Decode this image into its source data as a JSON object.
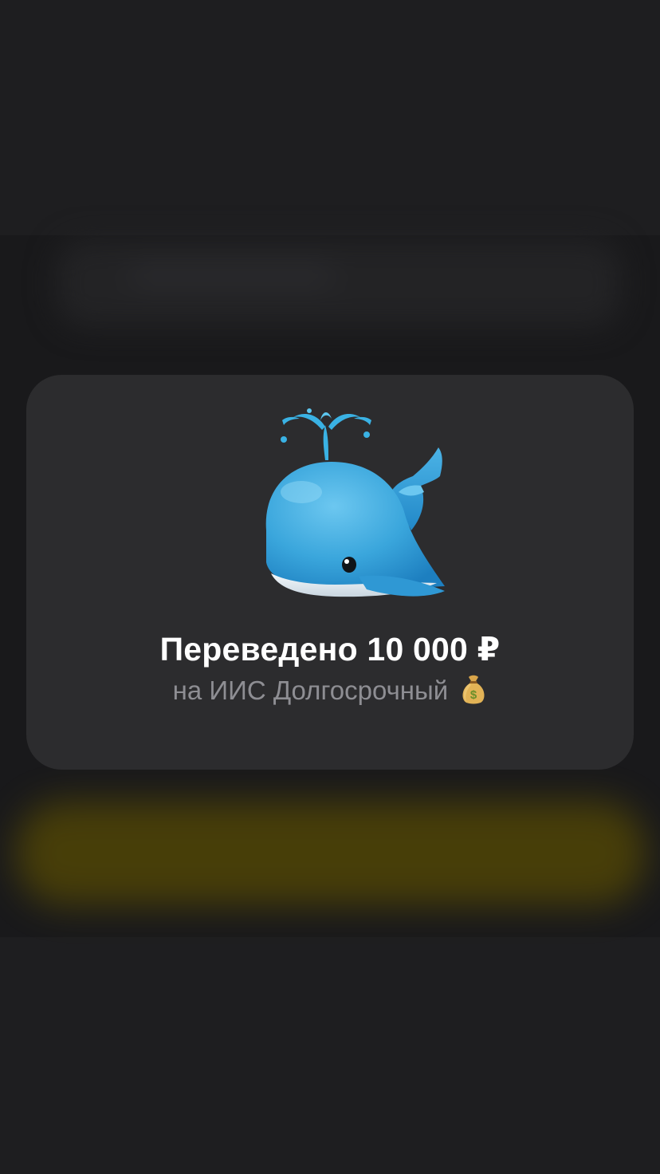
{
  "notification": {
    "title": "Переведено 10 000 ₽",
    "subtitle": "на ИИС Долгосрочный",
    "emoji_icon": "spouting-whale-icon",
    "trailing_emoji": "money-bag-icon"
  },
  "colors": {
    "background": "#1e1e20",
    "card": "#2c2c2e",
    "title": "#ffffff",
    "subtitle": "#8e8e93",
    "whale": "#3aa6dc",
    "accent_glow": "#4a4008"
  }
}
